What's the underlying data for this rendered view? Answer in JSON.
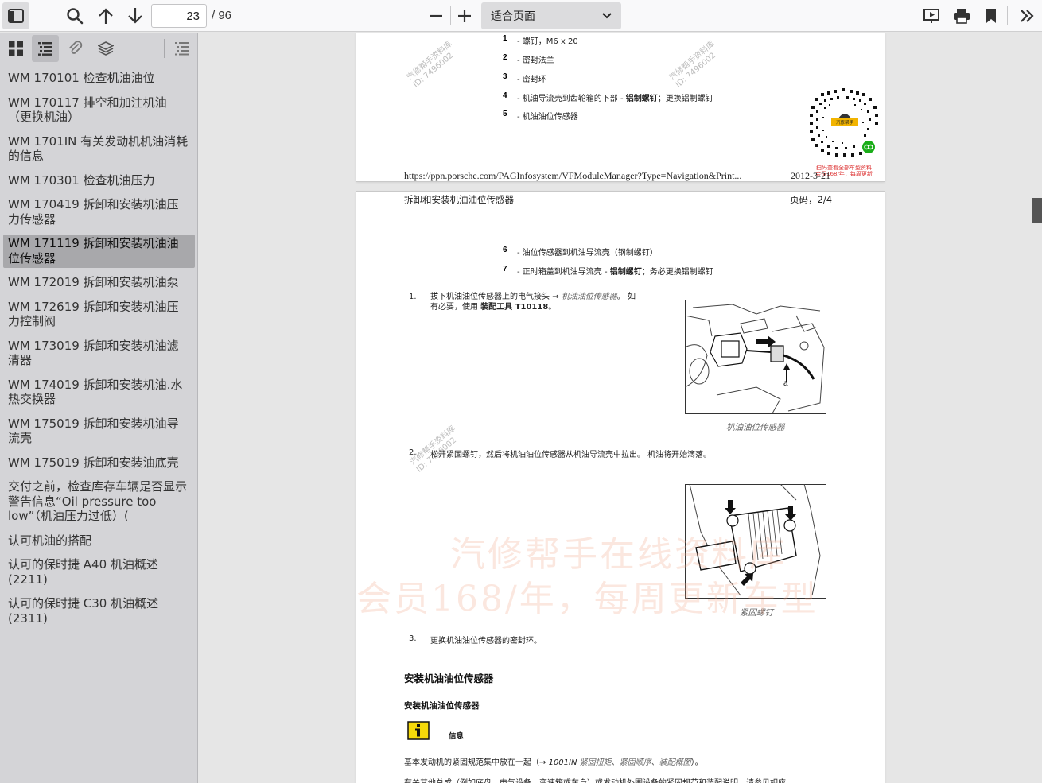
{
  "toolbar": {
    "page_number": "23",
    "page_total": "/ 96",
    "zoom_value": "适合页面"
  },
  "outline": [
    {
      "label": "WM 170101 检查机油油位"
    },
    {
      "label": "WM 170117 排空和加注机油（更换机油）"
    },
    {
      "label": "WM 1701IN 有关发动机机油消耗的信息"
    },
    {
      "label": "WM 170301 检查机油压力"
    },
    {
      "label": "WM 170419 拆卸和安装机油压力传感器"
    },
    {
      "label": "WM 171119 拆卸和安装机油油位传感器"
    },
    {
      "label": "WM 172019 拆卸和安装机油泵"
    },
    {
      "label": "WM 172619 拆卸和安装机油压力控制阀"
    },
    {
      "label": "WM 173019 拆卸和安装机油滤清器"
    },
    {
      "label": "WM 174019 拆卸和安装机油.水热交换器"
    },
    {
      "label": "WM 175019 拆卸和安装机油导流壳"
    },
    {
      "label": "WM 175019 拆卸和安装油底壳"
    },
    {
      "label": "交付之前，检查库存车辆是否显示警告信息“Oil pressure too low”（机油压力过低）("
    },
    {
      "label": "认可机油的搭配"
    },
    {
      "label": "认可的保时捷 A40 机油概述 (2211)"
    },
    {
      "label": "认可的保时捷 C30 机油概述 (2311)"
    }
  ],
  "page1": {
    "parts": [
      {
        "num": "1",
        "text": "- 螺钉，M6 x 20"
      },
      {
        "num": "2",
        "text": "- 密封法兰"
      },
      {
        "num": "3",
        "text": "- 密封环"
      },
      {
        "num": "4",
        "pre": "- 机油导流壳到齿轮箱的下部 - ",
        "bold": "铝制螺钉",
        "post": "；更换铝制螺钉"
      },
      {
        "num": "5",
        "text": "- 机油油位传感器"
      }
    ],
    "watermark_1": "汽修帮手资料库",
    "watermark_id": "ID: 7496002",
    "watermark_2": "汽修帮手资料库",
    "qr_brand": "汽修帮手",
    "qr_caption_1": "扫码查看全部车型资料",
    "qr_caption_2": "会员168/年，每周更新",
    "footer_url": "https://ppn.porsche.com/PAGInfosystem/VFModuleManager?Type=Navigation&Print...",
    "footer_date": "2012-3-21"
  },
  "page2": {
    "header_title": "拆卸和安装机油油位传感器",
    "header_page": "页码，2/4",
    "parts": [
      {
        "num": "6",
        "text": "- 油位传感器到机油导流壳（钢制螺钉）"
      },
      {
        "num": "7",
        "pre": "- 正时箱盖到机油导流壳 - ",
        "bold": "铝制螺钉",
        "post": "；务必更换铝制螺钉"
      }
    ],
    "step1_num": "1.",
    "step1_text_a": "拔下机油油位传感器上的电气接头",
    "step1_arrow": "→",
    "step1_link": "机油油位传感器",
    "step1_text_b": "。 如",
    "step1_text_c": "有必要，使用",
    "step1_tool": "装配工具 T10118",
    "step1_end": "。",
    "fig1_label": "a",
    "fig1_caption": "机油油位传感器",
    "watermark_3": "汽修帮手资料库",
    "step2_num": "2.",
    "step2_text": "松开紧固螺钉，然后将机油油位传感器从机油导流壳中拉出。 机油将开始滴落。",
    "fig2_caption": "紧固螺钉",
    "big_watermark_1": "汽修帮手在线资料库",
    "big_watermark_2": "会员168/年，每周更新车型",
    "step3_num": "3.",
    "step3_text": "更换机油油位传感器的密封环。",
    "section_title": "安装机油油位传感器",
    "sub_title": "安装机油油位传感器",
    "info_label": "信息",
    "info_text_a": "基本发动机的紧固规范集中放在一起（",
    "info_arrow": "→",
    "info_ref": "1001IN",
    "info_link": "紧固扭矩、紧固顺序、装配概图",
    "info_text_b": "）。",
    "cut_text": "有关其他总成（例如底盘、电气设备、变速箱或车身）或发动机外围设备的紧固规范和装配说明，请参见相应"
  }
}
